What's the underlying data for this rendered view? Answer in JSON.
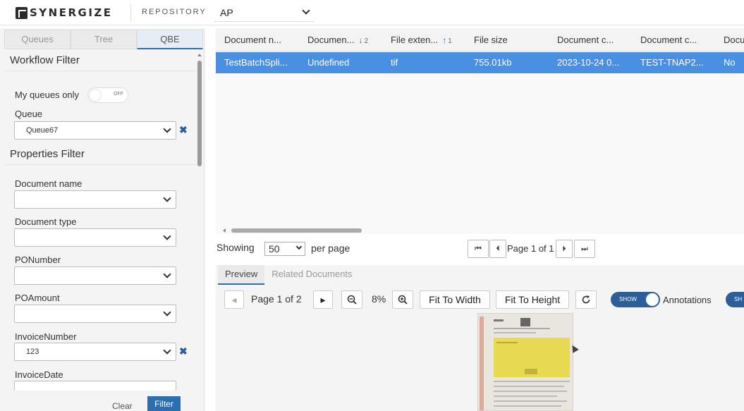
{
  "header": {
    "logo_text": "SYNERGIZE",
    "repository_label": "REPOSITORY",
    "repository_value": "AP"
  },
  "left_panel": {
    "tabs": [
      {
        "label": "Queues",
        "active": false
      },
      {
        "label": "Tree",
        "active": false
      },
      {
        "label": "QBE",
        "active": true
      }
    ],
    "workflow_filter_title": "Workflow Filter",
    "my_queues_label": "My queues only",
    "my_queues_toggle": "OFF",
    "queue_label": "Queue",
    "queue_value": "Queue67",
    "properties_filter_title": "Properties Filter",
    "fields": [
      {
        "label": "Document name",
        "value": ""
      },
      {
        "label": "Document type",
        "value": ""
      },
      {
        "label": "PONumber",
        "value": ""
      },
      {
        "label": "POAmount",
        "value": ""
      },
      {
        "label": "InvoiceNumber",
        "value": "123"
      },
      {
        "label": "InvoiceDate",
        "value": ""
      }
    ],
    "clear_label": "Clear",
    "filter_label": "Filter"
  },
  "grid": {
    "columns": [
      {
        "label": "Document n...",
        "sort": "",
        "sort_index": ""
      },
      {
        "label": "Documen...",
        "sort": "↓",
        "sort_index": "2"
      },
      {
        "label": "File exten...",
        "sort": "↑",
        "sort_index": "1"
      },
      {
        "label": "File size",
        "sort": "",
        "sort_index": ""
      },
      {
        "label": "Document c...",
        "sort": "",
        "sort_index": ""
      },
      {
        "label": "Document c...",
        "sort": "",
        "sort_index": ""
      },
      {
        "label": "Docu",
        "sort": "",
        "sort_index": ""
      }
    ],
    "rows": [
      [
        "TestBatchSpli...",
        "Undefined",
        "tif",
        "755.01kb",
        "2023-10-24 0...",
        "TEST-TNAP2...",
        "No"
      ]
    ]
  },
  "pagination": {
    "showing_label": "Showing",
    "per_page_value": "50",
    "per_page_label": "per page",
    "page_text": "Page 1 of 1"
  },
  "preview": {
    "tabs": [
      {
        "label": "Preview",
        "active": true
      },
      {
        "label": "Related Documents",
        "active": false
      }
    ],
    "page_text": "Page 1 of 2",
    "zoom": "8%",
    "fit_width_label": "Fit To Width",
    "fit_height_label": "Fit To Height",
    "show_label": "SHOW",
    "annotations_label": "Annotations",
    "show2_label": "SH"
  },
  "colors": {
    "accent": "#2c6fb0",
    "selected_row": "#4a90e2",
    "toggle_on": "#2c5f9a"
  }
}
